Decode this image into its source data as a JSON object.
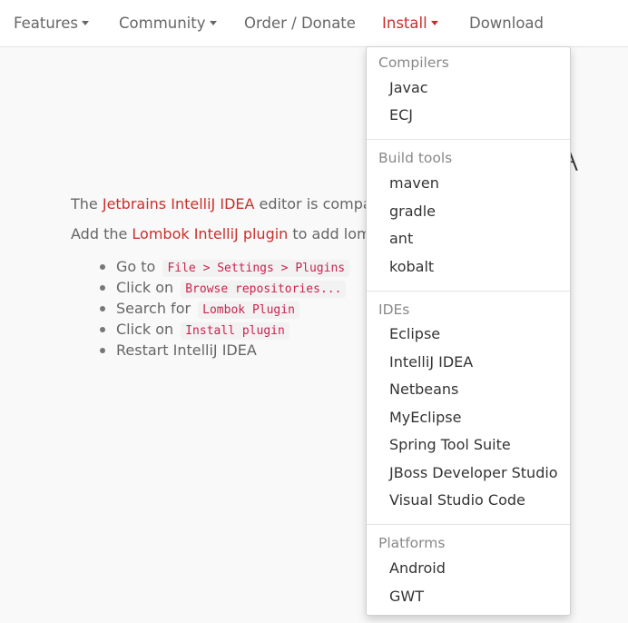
{
  "nav": {
    "features": "Features",
    "community": "Community",
    "order_donate": "Order / Donate",
    "install": "Install",
    "download": "Download"
  },
  "content": {
    "heading_fragment": "A",
    "para1": {
      "prefix": "The ",
      "link": "Jetbrains IntelliJ IDEA",
      "suffix": " editor is compatib"
    },
    "para2": {
      "prefix": "Add the ",
      "link": "Lombok IntelliJ plugin",
      "suffix": " to add lombo"
    },
    "steps": [
      {
        "text": "Go to",
        "code": "File > Settings > Plugins"
      },
      {
        "text": "Click on",
        "code": "Browse repositories..."
      },
      {
        "text": "Search for",
        "code": "Lombok Plugin"
      },
      {
        "text": "Click on",
        "code": "Install plugin"
      },
      {
        "text": "Restart IntelliJ IDEA",
        "code": ""
      }
    ]
  },
  "dropdown": {
    "compilers": {
      "header": "Compilers",
      "items": [
        "Javac",
        "ECJ"
      ]
    },
    "build_tools": {
      "header": "Build tools",
      "items": [
        "maven",
        "gradle",
        "ant",
        "kobalt"
      ]
    },
    "ides": {
      "header": "IDEs",
      "items": [
        "Eclipse",
        "IntelliJ IDEA",
        "Netbeans",
        "MyEclipse",
        "Spring Tool Suite",
        "JBoss Developer Studio",
        "Visual Studio Code"
      ]
    },
    "platforms": {
      "header": "Platforms",
      "items": [
        "Android",
        "GWT"
      ]
    }
  },
  "colors": {
    "accent": "#c9302c",
    "code_text": "#c7254e",
    "code_bg": "#f2f2f2"
  }
}
